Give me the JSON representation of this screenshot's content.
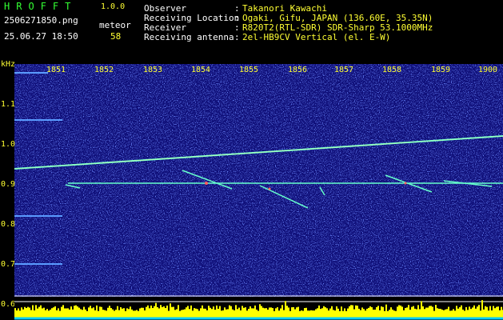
{
  "header": {
    "app_title": "HROFFT",
    "app_version": "1.0.0",
    "file_name": "2506271850.png",
    "timestamp": "25.06.27 18:50",
    "meteor_label": "meteor",
    "meteor_count": "58"
  },
  "station": [
    {
      "label": "Observer",
      "value": "Takanori Kawachi"
    },
    {
      "label": "Receiving Location",
      "value": "Ogaki, Gifu, JAPAN (136.60E, 35.35N)"
    },
    {
      "label": "Receiver",
      "value": "R820T2(RTL-SDR) SDR-Sharp 53.1000MHz"
    },
    {
      "label": "Receiving antenna",
      "value": "2el-HB9CV Vertical (el. E-W)"
    }
  ],
  "spectrogram": {
    "y_unit": "kHz",
    "y_ticks": [
      "1.1",
      "1.0",
      "0.9",
      "0.8",
      "0.7",
      "0.6"
    ],
    "x_ticks": [
      "1851",
      "1852",
      "1853",
      "1854",
      "1855",
      "1856",
      "1857",
      "1858",
      "1859",
      "1900"
    ],
    "colors": {
      "background": "#10107a",
      "noise": "#3050ff",
      "signal": "#66ffcc",
      "meteor_head": "#ff6060",
      "power_bar": "#ffff00",
      "power_base": "#00ccff",
      "tick_text": "#ffff33"
    }
  }
}
